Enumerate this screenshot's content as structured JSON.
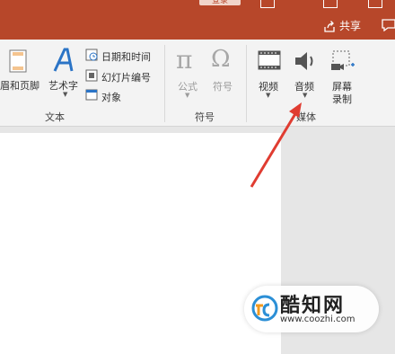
{
  "titlebar": {
    "login_label": "登录",
    "share_label": "共享",
    "accent_color": "#b7472a"
  },
  "ribbon": {
    "text_group": {
      "header_footer_label": "眉和页脚",
      "wordart_label": "艺术字",
      "date_time_label": "日期和时间",
      "slide_number_label": "幻灯片编号",
      "object_label": "对象",
      "group_label": "文本"
    },
    "symbols_group": {
      "equation_label": "公式",
      "symbol_label": "符号",
      "group_label": "符号"
    },
    "media_group": {
      "video_label": "视频",
      "audio_label": "音频",
      "screen_rec_label_1": "屏幕",
      "screen_rec_label_2": "录制",
      "group_label": "媒体"
    }
  },
  "watermark": {
    "name": "酷知网",
    "url": "www.coozhi.com"
  },
  "annotation": {
    "arrow_color": "#e03c31"
  }
}
